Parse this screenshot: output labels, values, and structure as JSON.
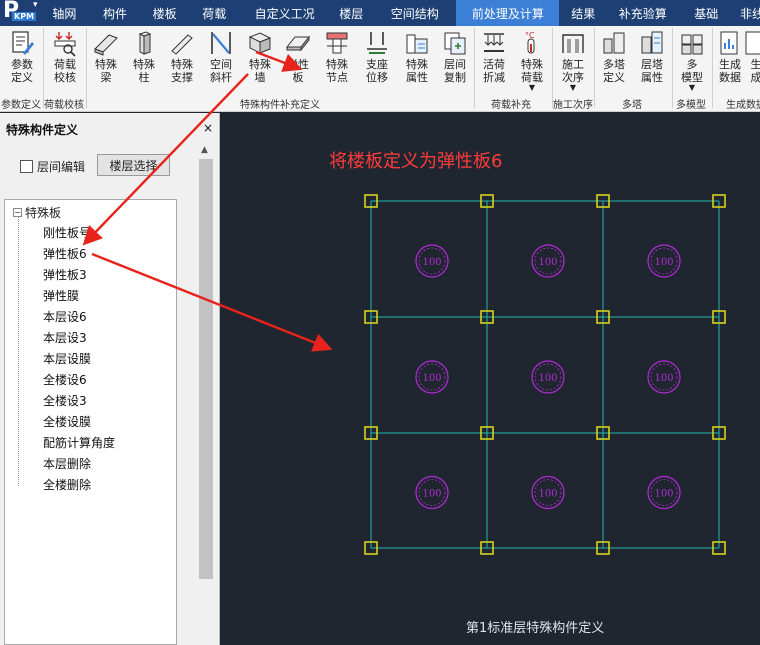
{
  "menubar": {
    "logo_text": "P",
    "logo_badge": "KPM",
    "tabs": [
      {
        "label": "轴网"
      },
      {
        "label": "构件"
      },
      {
        "label": "楼板"
      },
      {
        "label": "荷载"
      },
      {
        "label": "自定义工况"
      },
      {
        "label": "楼层"
      },
      {
        "label": "空间结构"
      },
      {
        "label": "前处理及计算",
        "active": true
      },
      {
        "label": "结果"
      },
      {
        "label": "补充验算"
      },
      {
        "label": "基础"
      },
      {
        "label": "非线"
      }
    ]
  },
  "ribbon": {
    "buttons": [
      {
        "label": "参数\n定义",
        "icon": "document-edit-icon"
      },
      {
        "label": "荷载\n校核",
        "icon": "load-check-icon"
      },
      {
        "label": "特殊\n梁",
        "icon": "special-beam-icon"
      },
      {
        "label": "特殊\n柱",
        "icon": "special-column-icon"
      },
      {
        "label": "特殊\n支撑",
        "icon": "special-brace-icon"
      },
      {
        "label": "空间\n斜杆",
        "icon": "space-diagonal-icon"
      },
      {
        "label": "特殊\n墙",
        "icon": "special-wall-icon"
      },
      {
        "label": "弹性\n板",
        "icon": "elastic-slab-icon"
      },
      {
        "label": "特殊\n节点",
        "icon": "special-node-icon"
      },
      {
        "label": "支座\n位移",
        "icon": "support-displacement-icon"
      },
      {
        "label": "特殊\n属性",
        "icon": "special-attribute-icon"
      },
      {
        "label": "层间\n复制",
        "icon": "floor-copy-icon"
      },
      {
        "label": "活荷\n折减",
        "icon": "live-load-reduction-icon"
      },
      {
        "label": "特殊\n荷载",
        "icon": "special-load-icon"
      },
      {
        "label": "施工\n次序",
        "icon": "construction-sequence-icon"
      },
      {
        "label": "多塔\n定义",
        "icon": "multi-tower-define-icon"
      },
      {
        "label": "层塔\n属性",
        "icon": "floor-tower-attribute-icon"
      },
      {
        "label": "多\n模型",
        "icon": "multi-model-icon"
      },
      {
        "label": "生成\n数据",
        "icon": "generate-data-icon"
      },
      {
        "label": "生\n成",
        "icon": "generate-icon"
      }
    ],
    "groups": [
      {
        "label": "参数定义"
      },
      {
        "label": "荷载校核"
      },
      {
        "label": "特殊构件补充定义"
      },
      {
        "label": "荷载补充"
      },
      {
        "label": "施工次序"
      },
      {
        "label": "多塔"
      },
      {
        "label": "多模型"
      },
      {
        "label": "生成数据"
      }
    ]
  },
  "panel": {
    "title": "特殊构件定义",
    "close": "×",
    "floor_edit_label": "层间编辑",
    "floor_select_label": "楼层选择",
    "tree": {
      "root_label": "特殊板",
      "items": [
        {
          "label": "刚性板号"
        },
        {
          "label": "弹性板6"
        },
        {
          "label": "弹性板3"
        },
        {
          "label": "弹性膜"
        },
        {
          "label": "本层设6"
        },
        {
          "label": "本层设3"
        },
        {
          "label": "本层设膜"
        },
        {
          "label": "全楼设6"
        },
        {
          "label": "全楼设3"
        },
        {
          "label": "全楼设膜"
        },
        {
          "label": "配筋计算角度"
        },
        {
          "label": "本层删除"
        },
        {
          "label": "全楼删除"
        }
      ]
    }
  },
  "canvas": {
    "annotation": "将楼板定义为弹性板6",
    "caption": "第1标准层特殊构件定义",
    "slab_labels": [
      "100",
      "100",
      "100",
      "100",
      "100",
      "100",
      "100",
      "100",
      "100"
    ],
    "colors": {
      "background": "#1f2630",
      "grid_line": "#22b9b5",
      "node": "#d7d31c",
      "slab_circle": "#b22bd6",
      "annotation": "#ff3b3b"
    }
  }
}
